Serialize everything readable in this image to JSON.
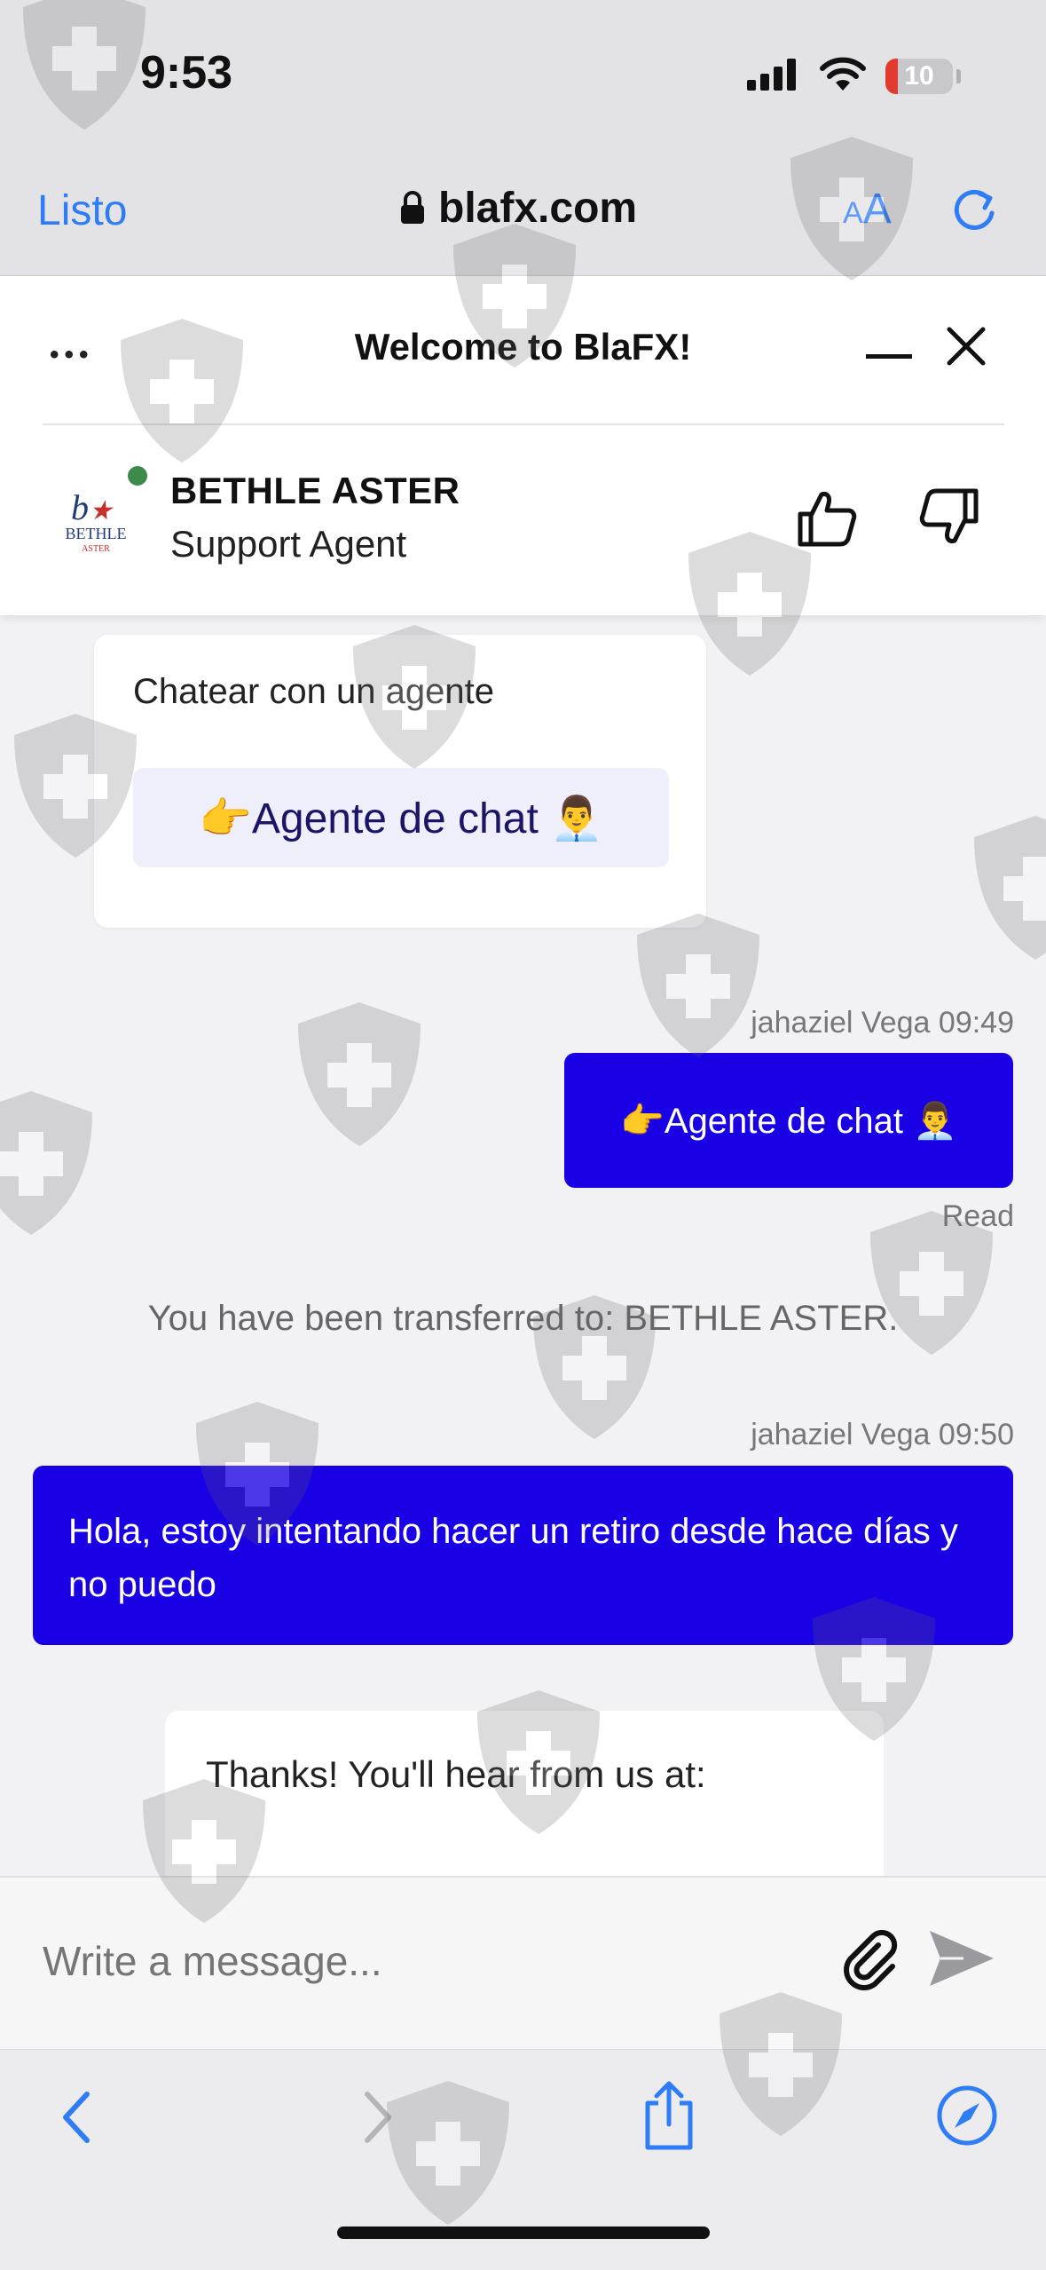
{
  "status": {
    "time": "9:53",
    "battery": "10"
  },
  "browser": {
    "done_label": "Listo",
    "url": "blafx.com",
    "aa_small": "A",
    "aa_large": "A"
  },
  "chat_header": {
    "title": "Welcome to BlaFX!",
    "agent_name": "BETHLE ASTER",
    "agent_role": "Support Agent",
    "logo_text": "BETHLE",
    "logo_subtext": "ASTER",
    "online_color": "#3c8a4c"
  },
  "messages": {
    "bot_card_text": "Chatear con un agente",
    "bot_card_button": "👉Agente de chat 👨‍💼",
    "out1_meta": "jahaziel Vega 09:49",
    "out1_text": "👉Agente de chat 👨‍💼",
    "out1_status": "Read",
    "system_text": "You have been transferred to: BETHLE ASTER.",
    "out2_meta": "jahaziel Vega 09:50",
    "out2_text": "Hola, estoy intentando hacer un retiro desde hace días y no puedo",
    "bot_card2_text": "Thanks! You'll hear from us at:"
  },
  "composer": {
    "placeholder": "Write a message..."
  },
  "colors": {
    "accent": "#2e7cf6",
    "bubble": "#1a00e5",
    "card_button": "#efeefb"
  }
}
